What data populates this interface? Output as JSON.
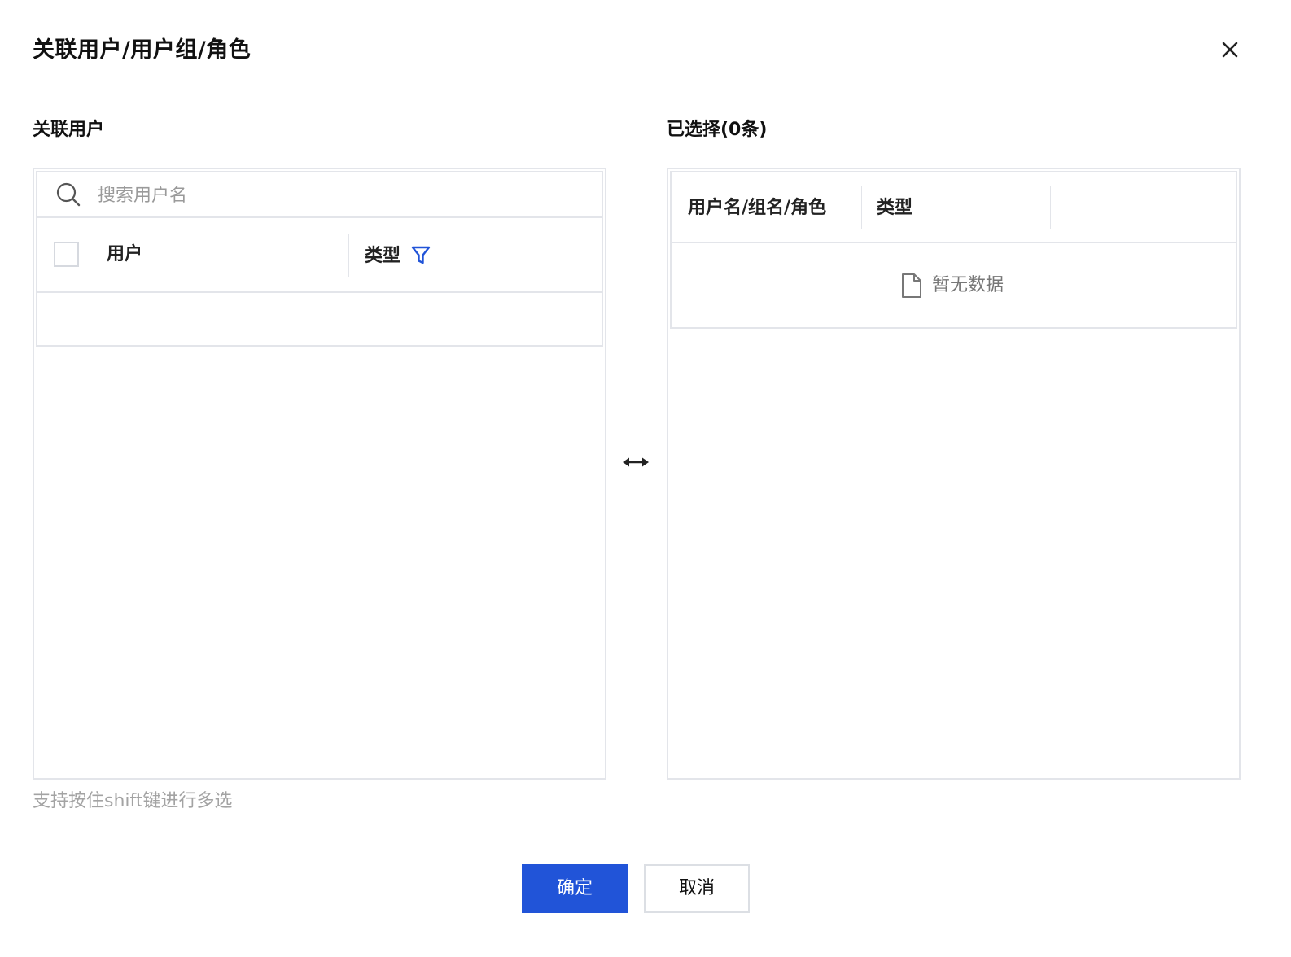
{
  "dialog": {
    "title": "关联用户/用户组/角色",
    "close_icon": "close-icon"
  },
  "left_panel": {
    "label": "关联用户",
    "search": {
      "placeholder": "搜索用户名",
      "value": "",
      "icon": "search-icon"
    },
    "columns": [
      {
        "label": "用户"
      },
      {
        "label": "类型",
        "icon": "filter-icon"
      }
    ],
    "rows": []
  },
  "right_panel": {
    "label": "已选择(0条)",
    "columns": [
      {
        "label": "用户名/组名/角色"
      },
      {
        "label": "类型"
      }
    ],
    "empty": {
      "icon": "file-icon",
      "text": "暂无数据"
    }
  },
  "hint": "支持按住shift键进行多选",
  "footer": {
    "confirm_label": "确定",
    "cancel_label": "取消"
  },
  "colors": {
    "primary": "#2154d8",
    "filter_icon": "#2154d8",
    "border": "#e3e5ea",
    "hint_text": "#a3a3a3"
  }
}
